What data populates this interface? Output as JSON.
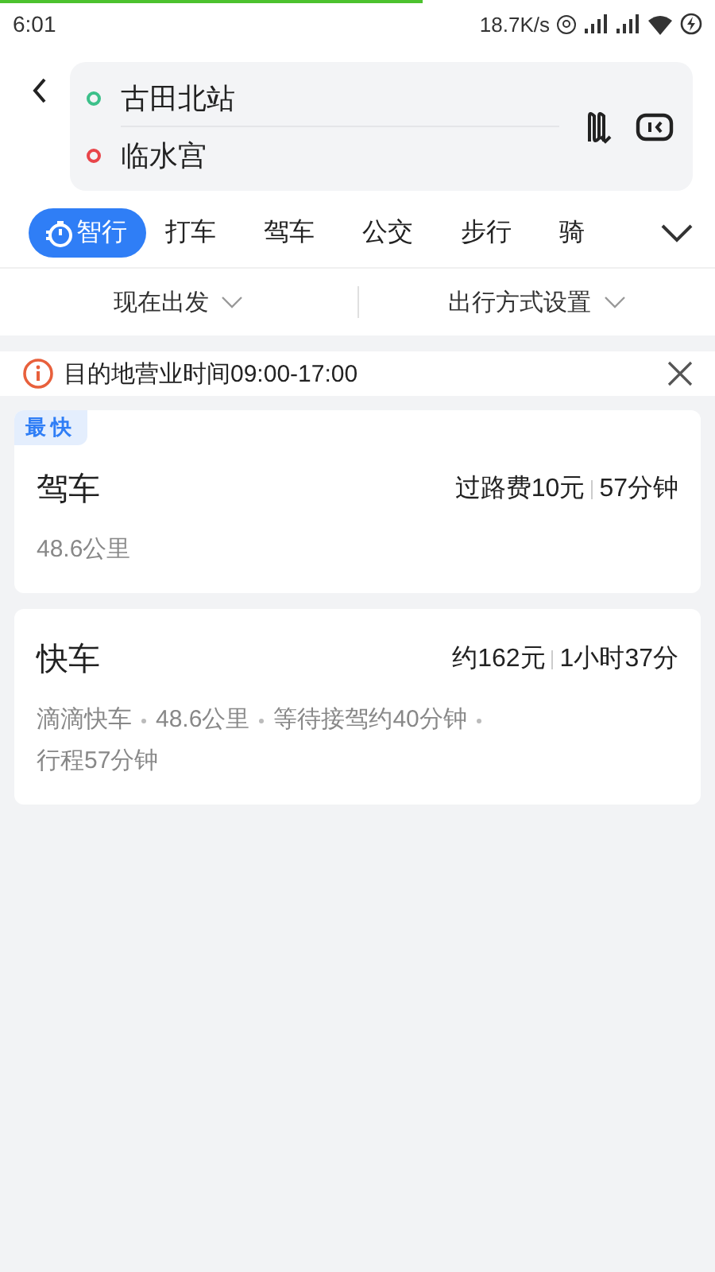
{
  "loading_bar": {
    "level": 0.59
  },
  "status_bar": {
    "time": "6:01",
    "speed": "18.7K/s"
  },
  "route": {
    "origin": "古田北站",
    "destination": "临水宫"
  },
  "tabs": [
    {
      "label": "智行",
      "selected": true
    },
    {
      "label": "打车",
      "selected": false
    },
    {
      "label": "驾车",
      "selected": false
    },
    {
      "label": "公交",
      "selected": false
    },
    {
      "label": "步行",
      "selected": false
    },
    {
      "label": "骑",
      "selected": false
    }
  ],
  "options": [
    "现在出发",
    "出行方式设置"
  ],
  "notice": "目的地营业时间09:00-17:00",
  "results": [
    {
      "badge": "最快",
      "title": "驾车",
      "metrics": [
        "过路费10元",
        "57分钟"
      ],
      "details": [
        "48.6公里"
      ]
    },
    {
      "title": "快车",
      "metrics": [
        "约162元",
        "1小时37分"
      ],
      "details": [
        "滴滴快车",
        "48.6公里",
        "等待接驾约40分钟",
        "行程57分钟"
      ]
    }
  ]
}
